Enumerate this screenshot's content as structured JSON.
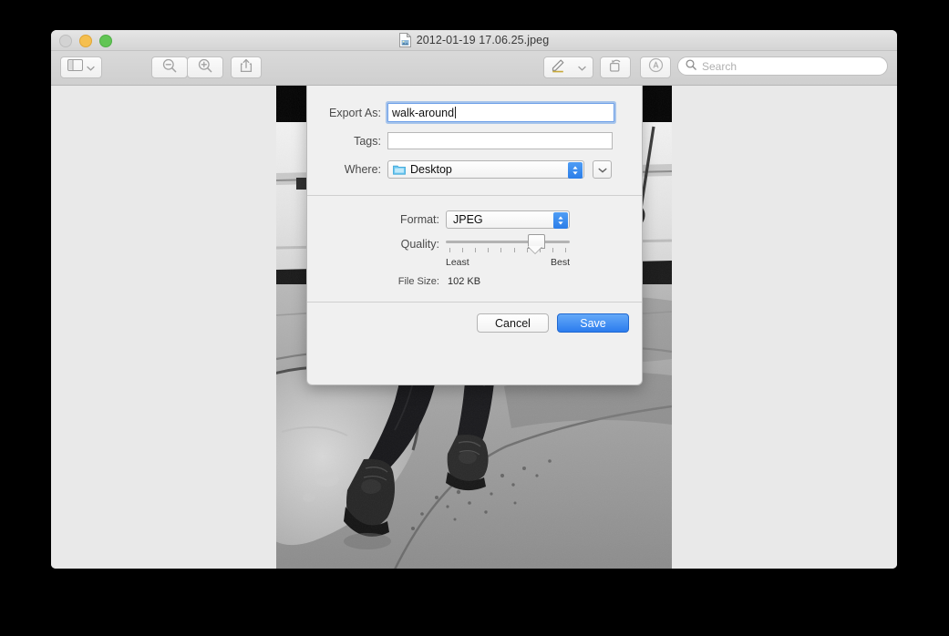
{
  "window": {
    "title": "2012-01-19 17.06.25.jpeg",
    "doc_icon": "document-image-icon",
    "traffic_lights": [
      {
        "name": "close-button",
        "color": "#d3d3d3",
        "label": "Close"
      },
      {
        "name": "minimize-button",
        "color": "#f5bf4f",
        "label": "Minimize"
      },
      {
        "name": "zoom-button",
        "color": "#61c554",
        "label": "Zoom"
      }
    ]
  },
  "toolbar": {
    "sidebar_icon": "sidebar-icon",
    "sidebar_chevron_icon": "chevron-down-icon",
    "zoom_out_icon": "magnifier-minus-icon",
    "zoom_in_icon": "magnifier-plus-icon",
    "share_icon": "share-up-arrow-icon",
    "markup_icon": "markup-pen-icon",
    "markup_chevron_icon": "chevron-down-icon",
    "rotate_icon": "rotate-left-icon",
    "annotate_icon": "annotate-circle-icon",
    "search": {
      "icon": "search-icon",
      "placeholder": "Search",
      "value": ""
    }
  },
  "photo": {
    "name": "preview-photo",
    "description": "Black and white photograph of a person's legs walking across wet cracked pavement"
  },
  "dialog": {
    "export_as": {
      "label": "Export As:",
      "value": "walk-around",
      "placeholder": ""
    },
    "tags": {
      "label": "Tags:",
      "value": "",
      "placeholder": ""
    },
    "where": {
      "label": "Where:",
      "value": "Desktop",
      "folder_icon": "folder-icon",
      "stepper_icon": "stepper-up-down-icon",
      "disclosure_icon": "chevron-down-icon"
    },
    "format": {
      "label": "Format:",
      "value": "JPEG",
      "stepper_icon": "stepper-up-down-icon"
    },
    "quality": {
      "label": "Quality:",
      "least_label": "Least",
      "best_label": "Best",
      "value_percent": 76,
      "tick_count": 10
    },
    "file_size": {
      "label": "File Size:",
      "value": "102 KB"
    },
    "buttons": {
      "cancel": "Cancel",
      "save": "Save"
    }
  },
  "colors": {
    "accent_blue": "#2b7cee",
    "focus_ring": "#6d9fe8",
    "window_bg": "#e9e9e9",
    "sheet_bg": "#f0f0f0"
  }
}
